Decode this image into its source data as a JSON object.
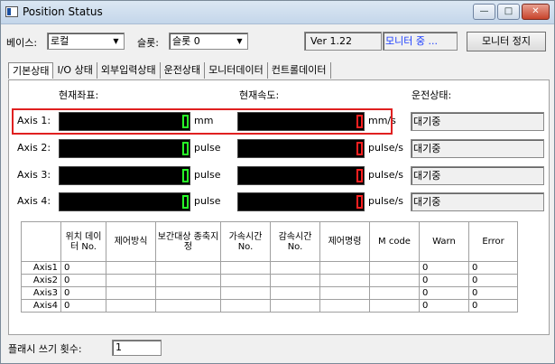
{
  "window": {
    "title": "Position Status",
    "min_glyph": "—",
    "max_glyph": "□",
    "close_glyph": "✕"
  },
  "toolbar": {
    "base_label": "베이스:",
    "base_value": "로컬",
    "slot_label": "슬롯:",
    "slot_value": "슬롯 0",
    "version": "Ver 1.22",
    "monitor_status": "모니터 중 ...",
    "stop_button": "모니터 정지",
    "arrow_glyph": "▼"
  },
  "tabs": [
    "기본상태",
    "I/O 상태",
    "외부입력상태",
    "운전상태",
    "모니터데이터",
    "컨트롤데이터"
  ],
  "headers": {
    "position": "현재좌표:",
    "speed": "현재속도:",
    "run_state": "운전상태:"
  },
  "axes": [
    {
      "label": "Axis 1:",
      "pos_unit": "mm",
      "speed_unit": "mm/s",
      "state": "대기중"
    },
    {
      "label": "Axis 2:",
      "pos_unit": "pulse",
      "speed_unit": "pulse/s",
      "state": "대기중"
    },
    {
      "label": "Axis 3:",
      "pos_unit": "pulse",
      "speed_unit": "pulse/s",
      "state": "대기중"
    },
    {
      "label": "Axis 4:",
      "pos_unit": "pulse",
      "speed_unit": "pulse/s",
      "state": "대기중"
    }
  ],
  "lcd_colors": {
    "position": "#28ff28",
    "speed": "#ff2020"
  },
  "table": {
    "columns": [
      "위치 데이터 No.",
      "제어방식",
      "보간대상 종축지정",
      "가속시간 No.",
      "감속시간 No.",
      "제어명령",
      "M code",
      "Warn",
      "Error"
    ],
    "rows": [
      {
        "name": "Axis1",
        "cells": [
          "0",
          "",
          "",
          "",
          "",
          "",
          "",
          "0",
          "0"
        ]
      },
      {
        "name": "Axis2",
        "cells": [
          "0",
          "",
          "",
          "",
          "",
          "",
          "",
          "0",
          "0"
        ]
      },
      {
        "name": "Axis3",
        "cells": [
          "0",
          "",
          "",
          "",
          "",
          "",
          "",
          "0",
          "0"
        ]
      },
      {
        "name": "Axis4",
        "cells": [
          "0",
          "",
          "",
          "",
          "",
          "",
          "",
          "0",
          "0"
        ]
      }
    ]
  },
  "flash": {
    "label": "플래시 쓰기 횟수:",
    "value": "1"
  }
}
